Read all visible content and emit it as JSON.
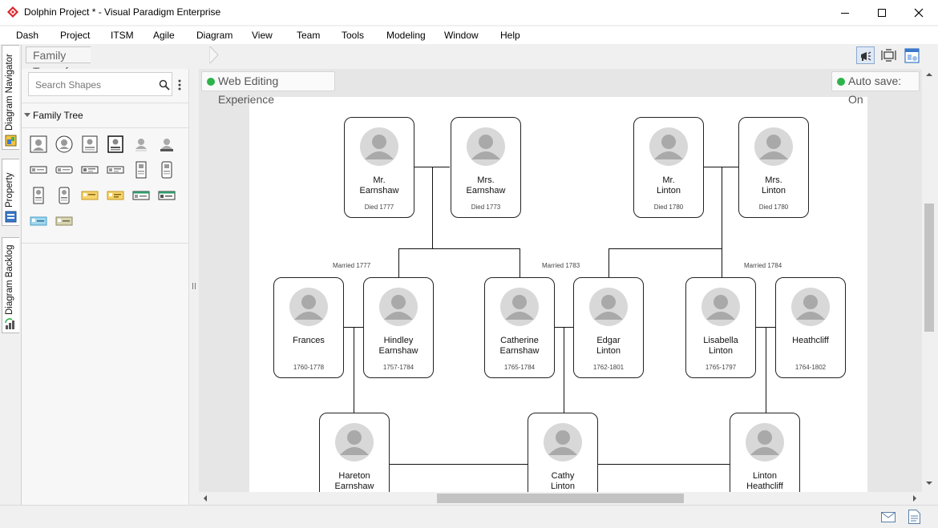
{
  "window": {
    "title": "Dolphin Project * - Visual Paradigm Enterprise",
    "accent_color": "#d9262c"
  },
  "menu": [
    "Dash",
    "Project",
    "ITSM",
    "Agile",
    "Diagram",
    "View",
    "Team",
    "Tools",
    "Modeling",
    "Window",
    "Help"
  ],
  "side_tabs": [
    "Diagram Navigator",
    "Property",
    "Diagram Backlog"
  ],
  "breadcrumb": {
    "diagram_name": "Family Tree of Wuthering Heights"
  },
  "palette": {
    "search_placeholder": "Search Shapes",
    "section": "Family Tree"
  },
  "canvas": {
    "web_editing": "Web Editing Experience",
    "autosave": "Auto save: On",
    "status_color": "#2eb34a"
  },
  "tree": {
    "people": [
      {
        "id": "mr_earnshaw",
        "name": "Mr.\nEarnshaw",
        "dates": "Died 1777"
      },
      {
        "id": "mrs_earnshaw",
        "name": "Mrs.\nEarnshaw",
        "dates": "Died 1773"
      },
      {
        "id": "mr_linton",
        "name": "Mr.\nLinton",
        "dates": "Died 1780"
      },
      {
        "id": "mrs_linton",
        "name": "Mrs.\nLinton",
        "dates": "Died 1780"
      },
      {
        "id": "frances",
        "name": "Frances",
        "dates": "1760-1778"
      },
      {
        "id": "hindley",
        "name": "Hindley\nEarnshaw",
        "dates": "1757-1784"
      },
      {
        "id": "catherine",
        "name": "Catherine\nEarnshaw",
        "dates": "1765-1784"
      },
      {
        "id": "edgar",
        "name": "Edgar\nLinton",
        "dates": "1762-1801"
      },
      {
        "id": "isabella",
        "name": "Lisabella\nLinton",
        "dates": "1765-1797"
      },
      {
        "id": "heathcliff",
        "name": "Heathcliff",
        "dates": "1764-1802"
      },
      {
        "id": "hareton",
        "name": "Hareton\nEarnshaw",
        "dates": ""
      },
      {
        "id": "cathy",
        "name": "Cathy\nLinton",
        "dates": ""
      },
      {
        "id": "linton",
        "name": "Linton\nHeathcliff",
        "dates": ""
      }
    ],
    "marriages": [
      {
        "id": "m1",
        "label": "Married 1777"
      },
      {
        "id": "m2",
        "label": "Married 1783"
      },
      {
        "id": "m3",
        "label": "Married 1784"
      }
    ]
  },
  "icons": [
    "app-logo-icon",
    "minimize-icon",
    "maximize-icon",
    "close-icon",
    "announcement-icon",
    "fit-screen-icon",
    "diagram-view-icon",
    "search-icon",
    "more-icon",
    "collapse-triangle-icon",
    "mail-icon",
    "document-icon"
  ]
}
